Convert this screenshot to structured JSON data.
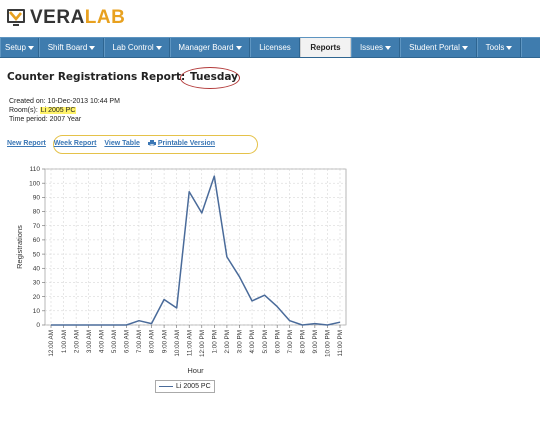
{
  "logo": {
    "text_a": "VERA",
    "text_b": "LAB"
  },
  "nav": {
    "items": [
      {
        "label": "Setup",
        "dropdown": true
      },
      {
        "label": "Shift Board",
        "dropdown": true
      },
      {
        "label": "Lab Control",
        "dropdown": true
      },
      {
        "label": "Manager Board",
        "dropdown": true
      },
      {
        "label": "Licenses",
        "dropdown": false
      },
      {
        "label": "Reports",
        "dropdown": false,
        "active": true
      },
      {
        "label": "Issues",
        "dropdown": true
      },
      {
        "label": "Student Portal",
        "dropdown": true
      },
      {
        "label": "Tools",
        "dropdown": true
      }
    ]
  },
  "report": {
    "title": "Counter Registrations Report:",
    "day": "Tuesday",
    "created_label": "Created on:",
    "created_value": "10-Dec-2013 10:44 PM",
    "rooms_label": "Room(s):",
    "rooms_value": "Li 2005 PC",
    "period_label": "Time period:",
    "period_value": "2007 Year"
  },
  "links": {
    "new_report": "New Report",
    "week_report": "Week Report",
    "view_table": "View Table",
    "printable": "Printable Version"
  },
  "colors": {
    "nav_bg": "#3f7cae",
    "series": "#4a6b9a",
    "highlight": "#fff36a",
    "day_circle": "#b23838",
    "links_oval": "#e5c24a"
  },
  "chart_data": {
    "type": "line",
    "xlabel": "Hour",
    "ylabel": "Registrations",
    "ylim": [
      0,
      110
    ],
    "yticks": [
      0,
      10,
      20,
      30,
      40,
      50,
      60,
      70,
      80,
      90,
      100,
      110
    ],
    "grid": true,
    "legend": "bottom",
    "categories": [
      "12:00 AM",
      "1:00 AM",
      "2:00 AM",
      "3:00 AM",
      "4:00 AM",
      "5:00 AM",
      "6:00 AM",
      "7:00 AM",
      "8:00 AM",
      "9:00 AM",
      "10:00 AM",
      "11:00 AM",
      "12:00 PM",
      "1:00 PM",
      "2:00 PM",
      "3:00 PM",
      "4:00 PM",
      "5:00 PM",
      "6:00 PM",
      "7:00 PM",
      "8:00 PM",
      "9:00 PM",
      "10:00 PM",
      "11:00 PM"
    ],
    "series": [
      {
        "name": "Li 2005 PC",
        "values": [
          0,
          0,
          0,
          0,
          0,
          0,
          0,
          3,
          1,
          18,
          12,
          94,
          79,
          105,
          48,
          34,
          17,
          21,
          13,
          3,
          0,
          1,
          0,
          2
        ]
      }
    ]
  }
}
